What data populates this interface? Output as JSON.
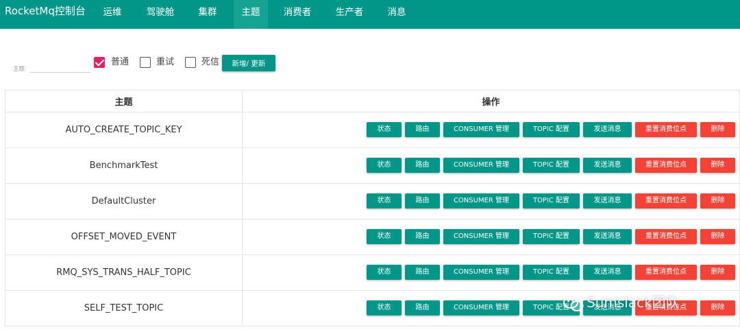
{
  "header": {
    "brand": "RocketMq控制台",
    "nav": [
      "运维",
      "驾驶舱",
      "集群",
      "主题",
      "消费者",
      "生产者",
      "消息"
    ],
    "active": "主题"
  },
  "filter": {
    "label": "主题",
    "value": "",
    "checkboxes": [
      {
        "label": "普通",
        "checked": true
      },
      {
        "label": "重试",
        "checked": false
      },
      {
        "label": "死信",
        "checked": false
      }
    ],
    "add_button": "新增/ 更新"
  },
  "table": {
    "headers": [
      "主题",
      "操作"
    ],
    "rows": [
      "AUTO_CREATE_TOPIC_KEY",
      "BenchmarkTest",
      "DefaultCluster",
      "OFFSET_MOVED_EVENT",
      "RMQ_SYS_TRANS_HALF_TOPIC",
      "SELF_TEST_TOPIC"
    ],
    "actions": [
      "状态",
      "路由",
      "CONSUMER 管理",
      "TOPIC 配置",
      "发送消息",
      "重置消费位点",
      "删除"
    ]
  },
  "watermark": "Sumslack团队",
  "colors": {
    "primary": "#009688",
    "danger": "#f44336",
    "checkbox_checked": "#e91e63"
  }
}
